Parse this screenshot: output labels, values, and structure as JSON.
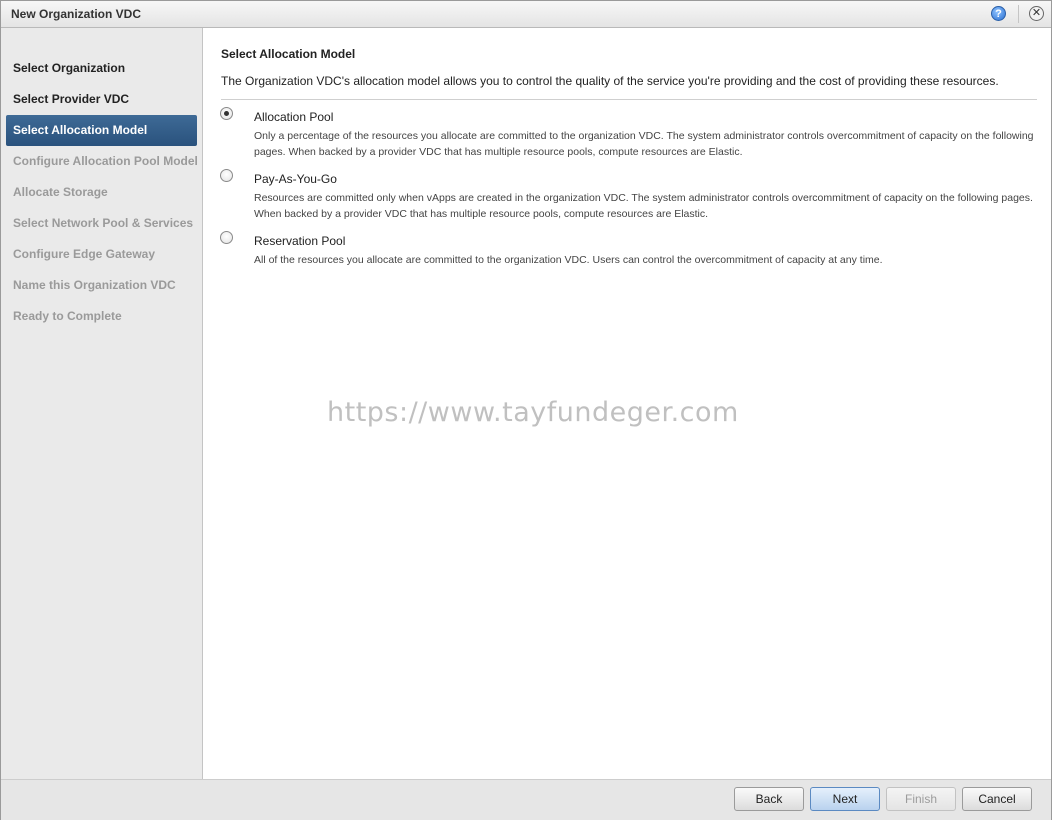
{
  "window": {
    "title": "New Organization VDC",
    "help_icon": "?",
    "close_icon": "✕"
  },
  "sidebar": {
    "steps": [
      {
        "label": "Select Organization",
        "state": "done"
      },
      {
        "label": "Select Provider VDC",
        "state": "done"
      },
      {
        "label": "Select Allocation Model",
        "state": "active"
      },
      {
        "label": "Configure Allocation Pool Model",
        "state": "todo"
      },
      {
        "label": "Allocate Storage",
        "state": "todo"
      },
      {
        "label": "Select Network Pool & Services",
        "state": "todo"
      },
      {
        "label": "Configure Edge Gateway",
        "state": "todo"
      },
      {
        "label": "Name this Organization VDC",
        "state": "todo"
      },
      {
        "label": "Ready to Complete",
        "state": "todo"
      }
    ]
  },
  "main": {
    "section_title": "Select Allocation Model",
    "description": "The Organization VDC's allocation model allows you to control the quality of the service you're providing and the cost of providing these resources.",
    "options": [
      {
        "label": "Allocation Pool",
        "selected": true,
        "description": "Only a percentage of the resources you allocate are committed to the organization VDC. The system administrator controls overcommitment of capacity on the following pages. When backed by a provider VDC that has multiple resource pools, compute resources are Elastic."
      },
      {
        "label": "Pay-As-You-Go",
        "selected": false,
        "description": "Resources are committed only when vApps are created in the organization VDC. The system administrator controls overcommitment of capacity on the following pages. When backed by a provider VDC that has multiple resource pools, compute resources are Elastic."
      },
      {
        "label": "Reservation Pool",
        "selected": false,
        "description": "All of the resources you allocate are committed to the organization VDC. Users can control the overcommitment of capacity at any time."
      }
    ],
    "watermark": "https://www.tayfundeger.com"
  },
  "footer": {
    "back_label": "Back",
    "next_label": "Next",
    "finish_label": "Finish",
    "cancel_label": "Cancel"
  },
  "colors": {
    "active_step_bg": "#2f5a86",
    "sidebar_bg": "#eaeaea",
    "disabled_text": "#9a9a9a"
  }
}
